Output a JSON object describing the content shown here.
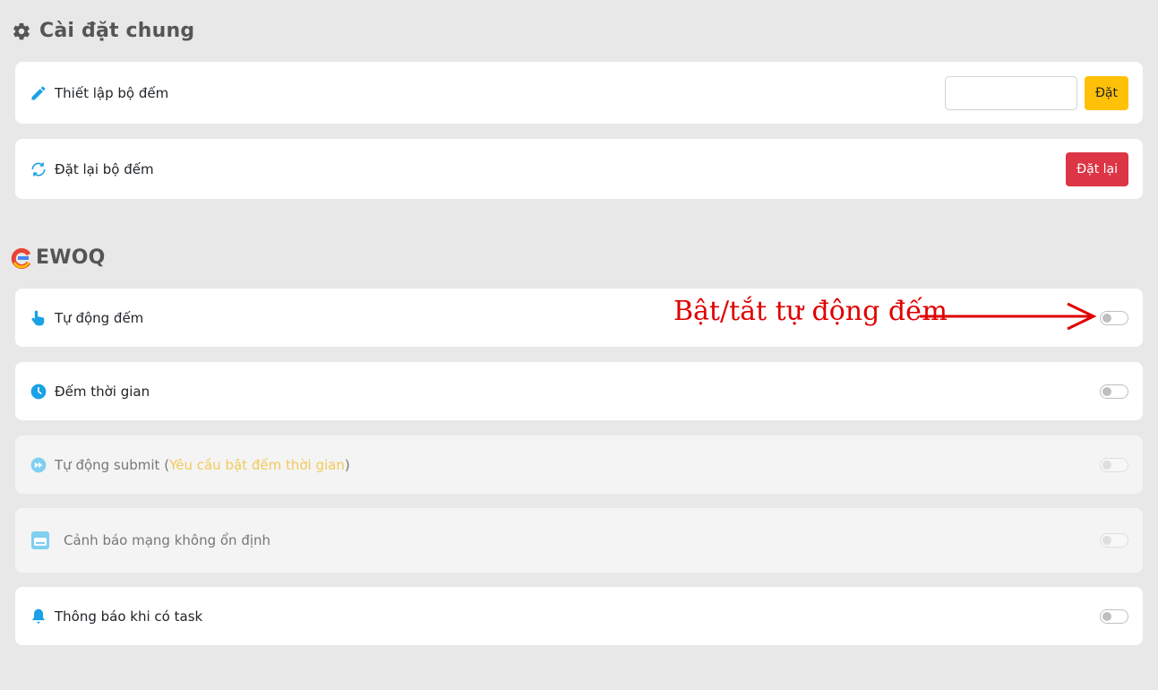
{
  "general": {
    "title": "Cài đặt chung",
    "counter_setup": {
      "label": "Thiết lập bộ đếm",
      "input_value": "",
      "button_label": "Đặt"
    },
    "counter_reset": {
      "label": "Đặt lại bộ đếm",
      "button_label": "Đặt lại"
    }
  },
  "ewoq": {
    "title": "EWOQ",
    "items": [
      {
        "label": "Tự động đếm",
        "icon": "hand-pointer-icon",
        "enabled": false
      },
      {
        "label": "Đếm thời gian",
        "icon": "clock-icon",
        "enabled": false
      },
      {
        "label": "Tự động submit (",
        "note": "Yêu cầu bật đếm thời gian",
        "suffix": ")",
        "icon": "fast-forward-icon",
        "enabled": false,
        "disabled": true
      },
      {
        "label": "Cảnh báo mạng không ổn định",
        "icon": "network-icon",
        "enabled": false,
        "disabled": true
      },
      {
        "label": "Thông báo khi có task",
        "icon": "bell-icon",
        "enabled": false
      }
    ]
  },
  "annotation": {
    "text": "Bật/tắt tự động đếm",
    "color": "#e00000"
  },
  "colors": {
    "accent_icon": "#1aa1e6",
    "warning": "#ffc107",
    "danger": "#dc3545",
    "background": "#e8e8e8"
  }
}
